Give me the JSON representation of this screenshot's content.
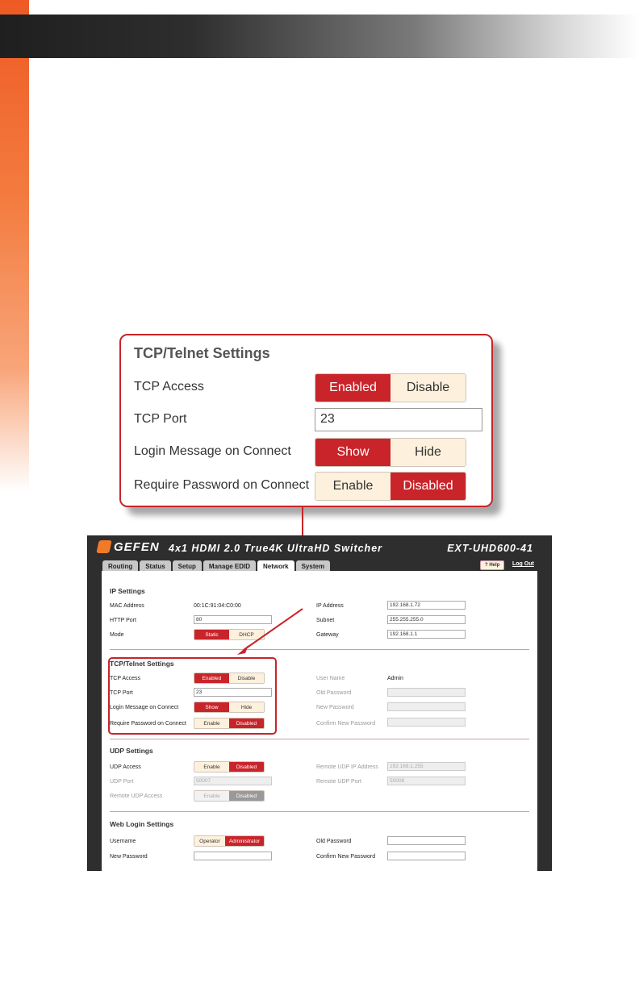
{
  "callout": {
    "title": "TCP/Telnet Settings",
    "tcp_access": {
      "label": "TCP Access",
      "on": "Enabled",
      "off": "Disable"
    },
    "tcp_port": {
      "label": "TCP Port",
      "value": "23"
    },
    "login_message": {
      "label": "Login Message on Connect",
      "on": "Show",
      "off": "Hide"
    },
    "require_password": {
      "label": "Require Password on Connect",
      "off": "Enable",
      "on": "Disabled"
    }
  },
  "app": {
    "logo": "GEFEN",
    "product": "4x1 HDMI 2.0 True4K UltraHD Switcher",
    "model": "EXT-UHD600-41",
    "tabs": [
      "Routing",
      "Status",
      "Setup",
      "Manage EDID",
      "Network",
      "System"
    ],
    "active_tab": "Network",
    "help": "? Help",
    "logout": "Log Out"
  },
  "ip": {
    "heading": "IP Settings",
    "mac_label": "MAC Address",
    "mac_value": "00:1C:91:04:C0:00",
    "http_label": "HTTP Port",
    "http_value": "80",
    "mode_label": "Mode",
    "mode_static": "Static",
    "mode_dhcp": "DHCP",
    "ip_label": "IP Address",
    "ip_value": "192.168.1.72",
    "subnet_label": "Subnet",
    "subnet_value": "255.255.255.0",
    "gateway_label": "Gateway",
    "gateway_value": "192.168.1.1"
  },
  "tcp": {
    "heading": "TCP/Telnet Settings",
    "access_label": "TCP Access",
    "access_on": "Enabled",
    "access_off": "Disable",
    "port_label": "TCP Port",
    "port_value": "23",
    "login_label": "Login Message on Connect",
    "login_show": "Show",
    "login_hide": "Hide",
    "pw_label": "Require Password on Connect",
    "pw_enable": "Enable",
    "pw_disabled": "Disabled",
    "user_label": "User Name",
    "user_value": "Admin",
    "old_pw_label": "Old Password",
    "new_pw_label": "New Password",
    "confirm_pw_label": "Confirm New Password"
  },
  "udp": {
    "heading": "UDP Settings",
    "access_label": "UDP Access",
    "access_enable": "Enable",
    "access_disabled": "Disabled",
    "port_label": "UDP Port",
    "port_value": "50007",
    "remote_access_label": "Remote UDP Access",
    "remote_enable": "Enable",
    "remote_disabled": "Disabled",
    "remote_ip_label": "Remote UDP IP Address",
    "remote_ip_value": "192.168.1.255",
    "remote_port_label": "Remote UDP Port",
    "remote_port_value": "50008"
  },
  "web": {
    "heading": "Web Login Settings",
    "username_label": "Username",
    "operator": "Operator",
    "administrator": "Administrator",
    "new_pw_label": "New Password",
    "old_pw_label": "Old Password",
    "confirm_pw_label": "Confirm New Password"
  },
  "colors": {
    "accent_red": "#c8242a",
    "off_button": "#fdf1dd",
    "orange": "#ee5a24"
  }
}
